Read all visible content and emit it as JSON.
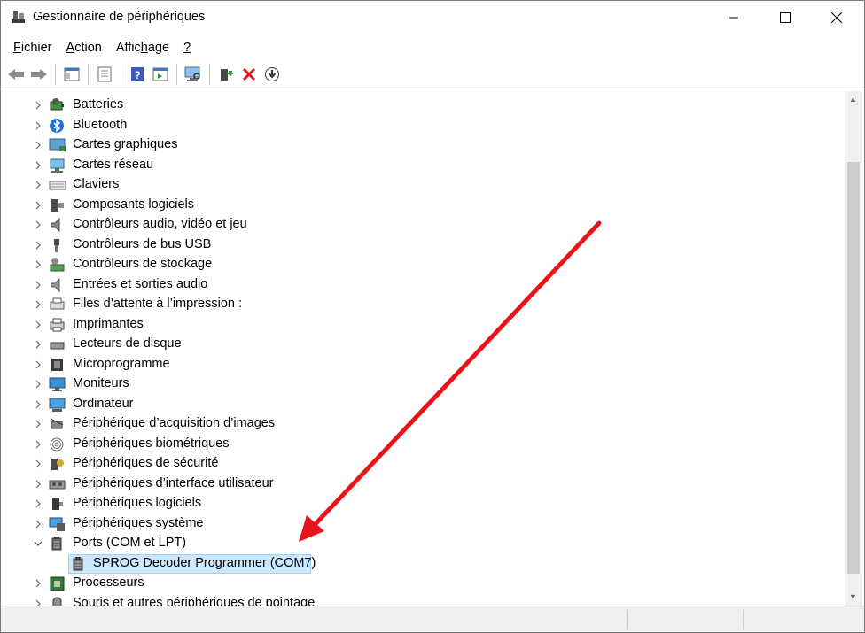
{
  "window": {
    "title": "Gestionnaire de périphériques"
  },
  "menu": [
    {
      "pre": "",
      "key": "F",
      "post": "ichier"
    },
    {
      "pre": "",
      "key": "A",
      "post": "ction"
    },
    {
      "pre": "Affic",
      "key": "h",
      "post": "age"
    },
    {
      "pre": "",
      "key": "?",
      "post": ""
    }
  ],
  "tree": {
    "items": [
      {
        "label": "Batteries",
        "icon": "battery-icon"
      },
      {
        "label": "Bluetooth",
        "icon": "bluetooth-icon"
      },
      {
        "label": "Cartes graphiques",
        "icon": "display-adapter-icon"
      },
      {
        "label": "Cartes réseau",
        "icon": "network-adapter-icon"
      },
      {
        "label": "Claviers",
        "icon": "keyboard-icon"
      },
      {
        "label": "Composants logiciels",
        "icon": "software-component-icon"
      },
      {
        "label": "Contrôleurs audio, vidéo et jeu",
        "icon": "speaker-icon"
      },
      {
        "label": "Contrôleurs de bus USB",
        "icon": "usb-icon"
      },
      {
        "label": "Contrôleurs de stockage",
        "icon": "storage-controller-icon"
      },
      {
        "label": "Entrées et sorties audio",
        "icon": "audio-io-icon"
      },
      {
        "label": "Files d’attente à l’impression :",
        "icon": "print-queue-icon"
      },
      {
        "label": "Imprimantes",
        "icon": "printer-icon"
      },
      {
        "label": "Lecteurs de disque",
        "icon": "disk-drive-icon"
      },
      {
        "label": "Microprogramme",
        "icon": "firmware-icon"
      },
      {
        "label": "Moniteurs",
        "icon": "monitor-icon"
      },
      {
        "label": "Ordinateur",
        "icon": "computer-icon"
      },
      {
        "label": "Périphérique d’acquisition d’images",
        "icon": "camera-icon"
      },
      {
        "label": "Périphériques biométriques",
        "icon": "fingerprint-icon"
      },
      {
        "label": "Périphériques de sécurité",
        "icon": "security-device-icon"
      },
      {
        "label": "Périphériques d’interface utilisateur",
        "icon": "hid-icon"
      },
      {
        "label": "Périphériques logiciels",
        "icon": "software-device-icon"
      },
      {
        "label": "Périphériques système",
        "icon": "system-device-icon"
      },
      {
        "label": "Ports (COM et LPT)",
        "icon": "port-icon",
        "expanded": true
      },
      {
        "label": "SPROG Decoder Programmer (COM7)",
        "icon": "port-icon",
        "child": true,
        "selected": true
      },
      {
        "label": "Processeurs",
        "icon": "processor-icon"
      },
      {
        "label": "Souris et autres périphériques de pointage",
        "icon": "mouse-icon"
      }
    ]
  },
  "colors": {
    "selection": "#cce8ff",
    "annotation_arrow": "#e8141a"
  }
}
